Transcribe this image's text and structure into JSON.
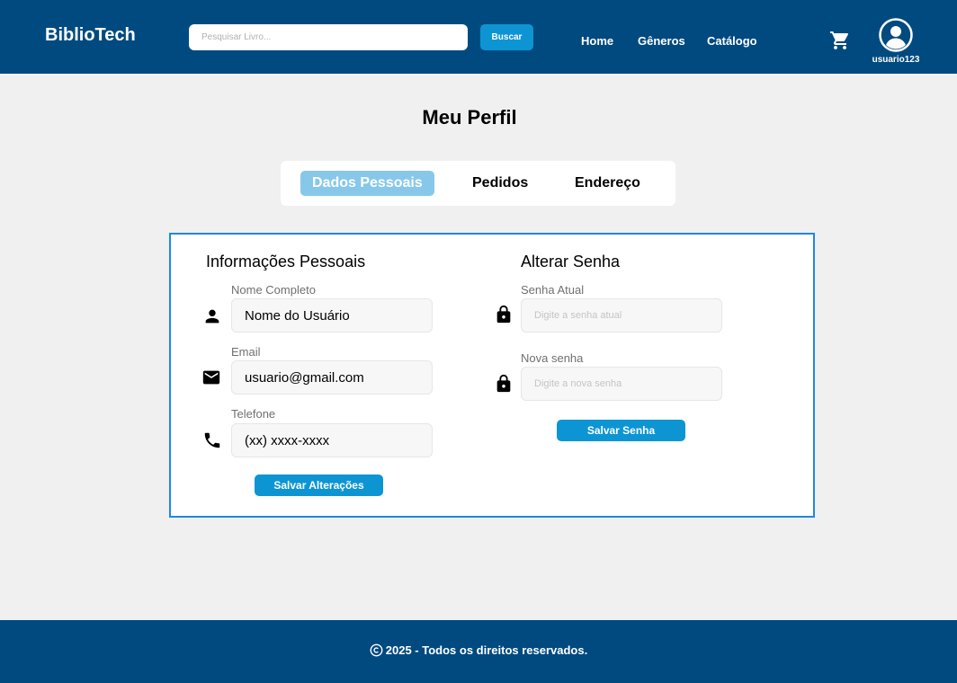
{
  "header": {
    "logo": "BiblioTech",
    "search": {
      "placeholder": "Pesquisar Livro...",
      "value": ""
    },
    "search_button": "Buscar",
    "nav": {
      "home": "Home",
      "genres": "Gêneros",
      "catalog": "Catálogo"
    },
    "username": "usuario123",
    "icons": {
      "cart": "cart-icon",
      "avatar": "account-circle-icon"
    }
  },
  "page": {
    "title": "Meu Perfil"
  },
  "tabs": [
    {
      "label": "Dados Pessoais",
      "active": true
    },
    {
      "label": "Pedidos",
      "active": false
    },
    {
      "label": "Endereço",
      "active": false
    }
  ],
  "personal": {
    "title": "Informações Pessoais",
    "name": {
      "label": "Nome Completo",
      "value": "Nome do Usuário",
      "icon": "person-icon"
    },
    "email": {
      "label": "Email",
      "value": "usuario@gmail.com",
      "icon": "email-icon"
    },
    "phone": {
      "label": "Telefone",
      "value": "(xx) xxxx-xxxx",
      "icon": "phone-icon"
    },
    "save_button": "Salvar Alterações"
  },
  "password": {
    "title": "Alterar Senha",
    "current": {
      "label": "Senha Atual",
      "placeholder": "Digite a senha atual",
      "value": "",
      "icon": "lock-icon"
    },
    "new": {
      "label": "Nova senha",
      "placeholder": "Digite a nova senha",
      "value": "",
      "icon": "lock-icon"
    },
    "save_button": "Salvar Senha"
  },
  "footer": {
    "copyright": "2025 - Todos os direitos reservados."
  },
  "colors": {
    "header_bg": "#004a80",
    "accent": "#0d95d3",
    "active_tab": "#87c8ea",
    "card_border": "#1e88e5",
    "page_bg": "#f0f0f0"
  }
}
